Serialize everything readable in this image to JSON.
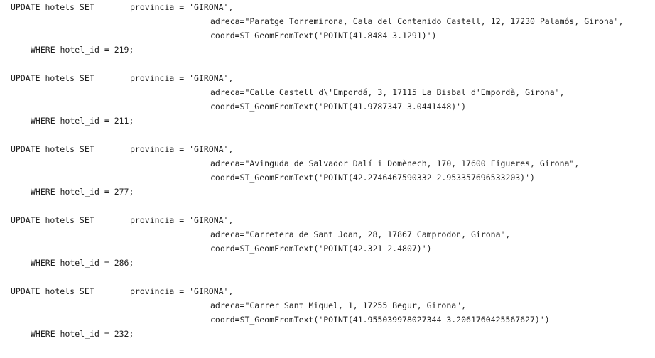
{
  "statements": [
    {
      "head": "UPDATE hotels SET",
      "set_provincia": "provincia = 'GIRONA',",
      "set_adreca": "adreca=\"Paratge Torremirona, Cala del Contenido Castell, 12, 17230 Palamós, Girona\",",
      "set_coord": "coord=ST_GeomFromText('POINT(41.8484 3.1291)')",
      "where": "WHERE hotel_id = 219;"
    },
    {
      "head": "UPDATE hotels SET",
      "set_provincia": "provincia = 'GIRONA',",
      "set_adreca": "adreca=\"Calle Castell d\\'Empordá, 3, 17115 La Bisbal d'Empordà, Girona\",",
      "set_coord": "coord=ST_GeomFromText('POINT(41.9787347 3.0441448)')",
      "where": "WHERE hotel_id = 211;"
    },
    {
      "head": "UPDATE hotels SET",
      "set_provincia": "provincia = 'GIRONA',",
      "set_adreca": "adreca=\"Avinguda de Salvador Dalí i Domènech, 170, 17600 Figueres, Girona\",",
      "set_coord": "coord=ST_GeomFromText('POINT(42.2746467590332 2.953357696533203)')",
      "where": "WHERE hotel_id = 277;"
    },
    {
      "head": "UPDATE hotels SET",
      "set_provincia": "provincia = 'GIRONA',",
      "set_adreca": "adreca=\"Carretera de Sant Joan, 28, 17867 Camprodon, Girona\",",
      "set_coord": "coord=ST_GeomFromText('POINT(42.321 2.4807)')",
      "where": "WHERE hotel_id = 286;"
    },
    {
      "head": "UPDATE hotels SET",
      "set_provincia": "provincia = 'GIRONA',",
      "set_adreca": "adreca=\"Carrer Sant Miquel, 1, 17255 Begur, Girona\",",
      "set_coord": "coord=ST_GeomFromText('POINT(41.955039978027344 3.2061760425567627)')",
      "where": "WHERE hotel_id = 232;"
    }
  ]
}
